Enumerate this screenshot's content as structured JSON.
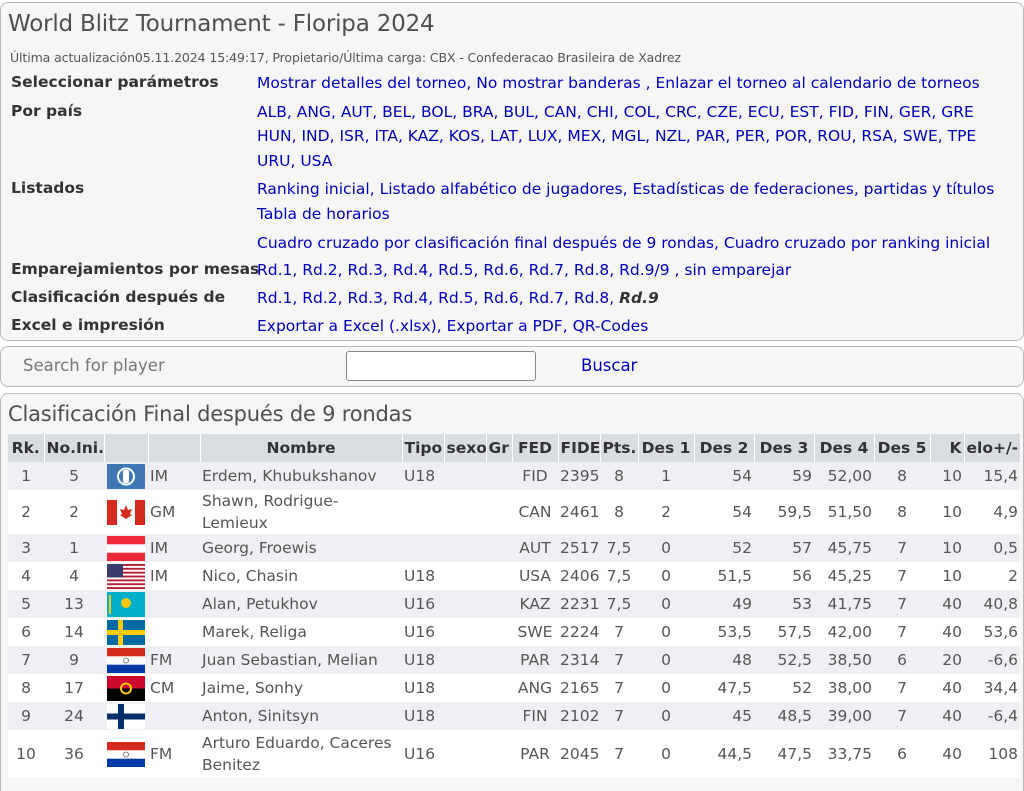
{
  "header": {
    "title": "World Blitz Tournament - Floripa 2024",
    "subtitle": "Última actualización05.11.2024 15:49:17, Propietario/Última carga: CBX - Confederacao Brasileira de Xadrez"
  },
  "params": {
    "select_label": "Seleccionar parámetros",
    "select_links": [
      "Mostrar detalles del torneo",
      "No mostrar banderas ",
      "Enlazar el torneo al calendario de torneos"
    ],
    "country_label": "Por país",
    "countries": [
      [
        "ALB",
        "ANG",
        "AUT",
        "BEL",
        "BOL",
        "BRA",
        "BUL",
        "CAN",
        "CHI",
        "COL",
        "CRC",
        "CZE",
        "ECU",
        "EST",
        "FID",
        "FIN",
        "GER",
        "GRE"
      ],
      [
        "HUN",
        "IND",
        "ISR",
        "ITA",
        "KAZ",
        "KOS",
        "LAT",
        "LUX",
        "MEX",
        "MGL",
        "NZL",
        "PAR",
        "PER",
        "POR",
        "ROU",
        "RSA",
        "SWE",
        "TPE"
      ],
      [
        "URU",
        "USA"
      ]
    ],
    "lists_label": "Listados",
    "lists_line1": [
      "Ranking inicial",
      "Listado alfabético de jugadores",
      "Estadísticas de federaciones, partidas y títulos"
    ],
    "lists_line2": [
      "Tabla de horarios"
    ],
    "lists_line3": [
      "Cuadro cruzado por clasificación final después de 9 rondas",
      "Cuadro cruzado por ranking inicial"
    ],
    "pairings_label": "Emparejamientos por mesas",
    "pairings": [
      "Rd.1",
      "Rd.2",
      "Rd.3",
      "Rd.4",
      "Rd.5",
      "Rd.6",
      "Rd.7",
      "Rd.8",
      "Rd.9/9 ",
      "sin emparejar"
    ],
    "standings_label": "Clasificación después de",
    "standings": [
      "Rd.1",
      "Rd.2",
      "Rd.3",
      "Rd.4",
      "Rd.5",
      "Rd.6",
      "Rd.7",
      "Rd.8"
    ],
    "standings_current": "Rd.9",
    "excel_label": "Excel e impresión",
    "excel_links": [
      "Exportar a Excel (.xlsx)",
      "Exportar a PDF",
      "QR-Codes"
    ]
  },
  "search": {
    "label": "Search for player",
    "value": "",
    "button": "Buscar"
  },
  "standings_table": {
    "title": "Clasificación Final después de 9 rondas",
    "columns": [
      "Rk.",
      "No.Ini.",
      "",
      "",
      "Nombre",
      "Tipo",
      "sexo",
      "Gr",
      "FED",
      "FIDE",
      "Pts.",
      "Des 1",
      "Des 2",
      "Des 3",
      "Des 4",
      "Des 5",
      "K",
      "elo+/-"
    ],
    "rows": [
      {
        "rk": "1",
        "no": "5",
        "flag": "fide",
        "title": "IM",
        "name": "Erdem, Khubukshanov",
        "type": "U18",
        "sex": "",
        "gr": "",
        "fed": "FID",
        "fide": "2395",
        "pts": "8",
        "d1": "1",
        "d2": "54",
        "d3": "59",
        "d4": "52,00",
        "d5": "8",
        "k": "10",
        "elo": "15,4"
      },
      {
        "rk": "2",
        "no": "2",
        "flag": "can",
        "title": "GM",
        "name": "Shawn, Rodrigue-Lemieux",
        "type": "",
        "sex": "",
        "gr": "",
        "fed": "CAN",
        "fide": "2461",
        "pts": "8",
        "d1": "2",
        "d2": "54",
        "d3": "59,5",
        "d4": "51,50",
        "d5": "8",
        "k": "10",
        "elo": "4,9"
      },
      {
        "rk": "3",
        "no": "1",
        "flag": "aut",
        "title": "IM",
        "name": "Georg, Froewis",
        "type": "",
        "sex": "",
        "gr": "",
        "fed": "AUT",
        "fide": "2517",
        "pts": "7,5",
        "d1": "0",
        "d2": "52",
        "d3": "57",
        "d4": "45,75",
        "d5": "7",
        "k": "10",
        "elo": "0,5"
      },
      {
        "rk": "4",
        "no": "4",
        "flag": "usa",
        "title": "IM",
        "name": "Nico, Chasin",
        "type": "U18",
        "sex": "",
        "gr": "",
        "fed": "USA",
        "fide": "2406",
        "pts": "7,5",
        "d1": "0",
        "d2": "51,5",
        "d3": "56",
        "d4": "45,25",
        "d5": "7",
        "k": "10",
        "elo": "2"
      },
      {
        "rk": "5",
        "no": "13",
        "flag": "kaz",
        "title": "",
        "name": "Alan, Petukhov",
        "type": "U16",
        "sex": "",
        "gr": "",
        "fed": "KAZ",
        "fide": "2231",
        "pts": "7,5",
        "d1": "0",
        "d2": "49",
        "d3": "53",
        "d4": "41,75",
        "d5": "7",
        "k": "40",
        "elo": "40,8"
      },
      {
        "rk": "6",
        "no": "14",
        "flag": "swe",
        "title": "",
        "name": "Marek, Religa",
        "type": "U16",
        "sex": "",
        "gr": "",
        "fed": "SWE",
        "fide": "2224",
        "pts": "7",
        "d1": "0",
        "d2": "53,5",
        "d3": "57,5",
        "d4": "42,00",
        "d5": "7",
        "k": "40",
        "elo": "53,6"
      },
      {
        "rk": "7",
        "no": "9",
        "flag": "par",
        "title": "FM",
        "name": "Juan Sebastian, Melian",
        "type": "U18",
        "sex": "",
        "gr": "",
        "fed": "PAR",
        "fide": "2314",
        "pts": "7",
        "d1": "0",
        "d2": "48",
        "d3": "52,5",
        "d4": "38,50",
        "d5": "6",
        "k": "20",
        "elo": "-6,6"
      },
      {
        "rk": "8",
        "no": "17",
        "flag": "ang",
        "title": "CM",
        "name": "Jaime, Sonhy",
        "type": "U18",
        "sex": "",
        "gr": "",
        "fed": "ANG",
        "fide": "2165",
        "pts": "7",
        "d1": "0",
        "d2": "47,5",
        "d3": "52",
        "d4": "38,00",
        "d5": "7",
        "k": "40",
        "elo": "34,4"
      },
      {
        "rk": "9",
        "no": "24",
        "flag": "fin",
        "title": "",
        "name": "Anton, Sinitsyn",
        "type": "U18",
        "sex": "",
        "gr": "",
        "fed": "FIN",
        "fide": "2102",
        "pts": "7",
        "d1": "0",
        "d2": "45",
        "d3": "48,5",
        "d4": "39,00",
        "d5": "7",
        "k": "40",
        "elo": "-6,4"
      },
      {
        "rk": "10",
        "no": "36",
        "flag": "par",
        "title": "FM",
        "name": "Arturo Eduardo, Caceres Benitez",
        "type": "U16",
        "sex": "",
        "gr": "",
        "fed": "PAR",
        "fide": "2045",
        "pts": "7",
        "d1": "0",
        "d2": "44,5",
        "d3": "47,5",
        "d4": "33,75",
        "d5": "6",
        "k": "40",
        "elo": "108"
      }
    ]
  }
}
